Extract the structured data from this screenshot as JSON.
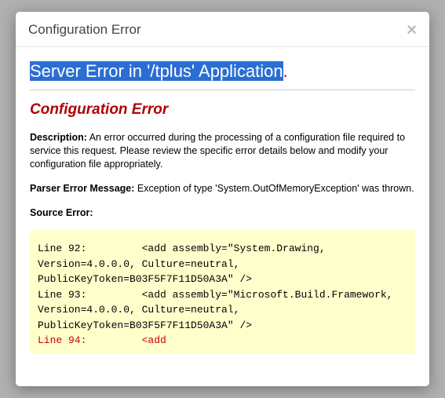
{
  "modal": {
    "title": "Configuration Error",
    "close_label": "×"
  },
  "content": {
    "server_error_title": "Server Error in '/tplus' Application",
    "period": ".",
    "config_error_heading": "Configuration Error",
    "description_label": "Description:",
    "description_text": " An error occurred during the processing of a configuration file required to service this request. Please review the specific error details below and modify your configuration file appropriately.",
    "parser_label": "Parser Error Message:",
    "parser_text": " Exception of type 'System.OutOfMemoryException' was thrown.",
    "source_label": "Source Error:",
    "source_lines": {
      "l92": "Line 92:         <add assembly=\"System.Drawing, Version=4.0.0.0, Culture=neutral, PublicKeyToken=B03F5F7F11D50A3A\" />",
      "l93": "Line 93:         <add assembly=\"Microsoft.Build.Framework, Version=4.0.0.0, Culture=neutral, PublicKeyToken=B03F5F7F11D50A3A\" />",
      "l94": "Line 94:         <add"
    }
  }
}
